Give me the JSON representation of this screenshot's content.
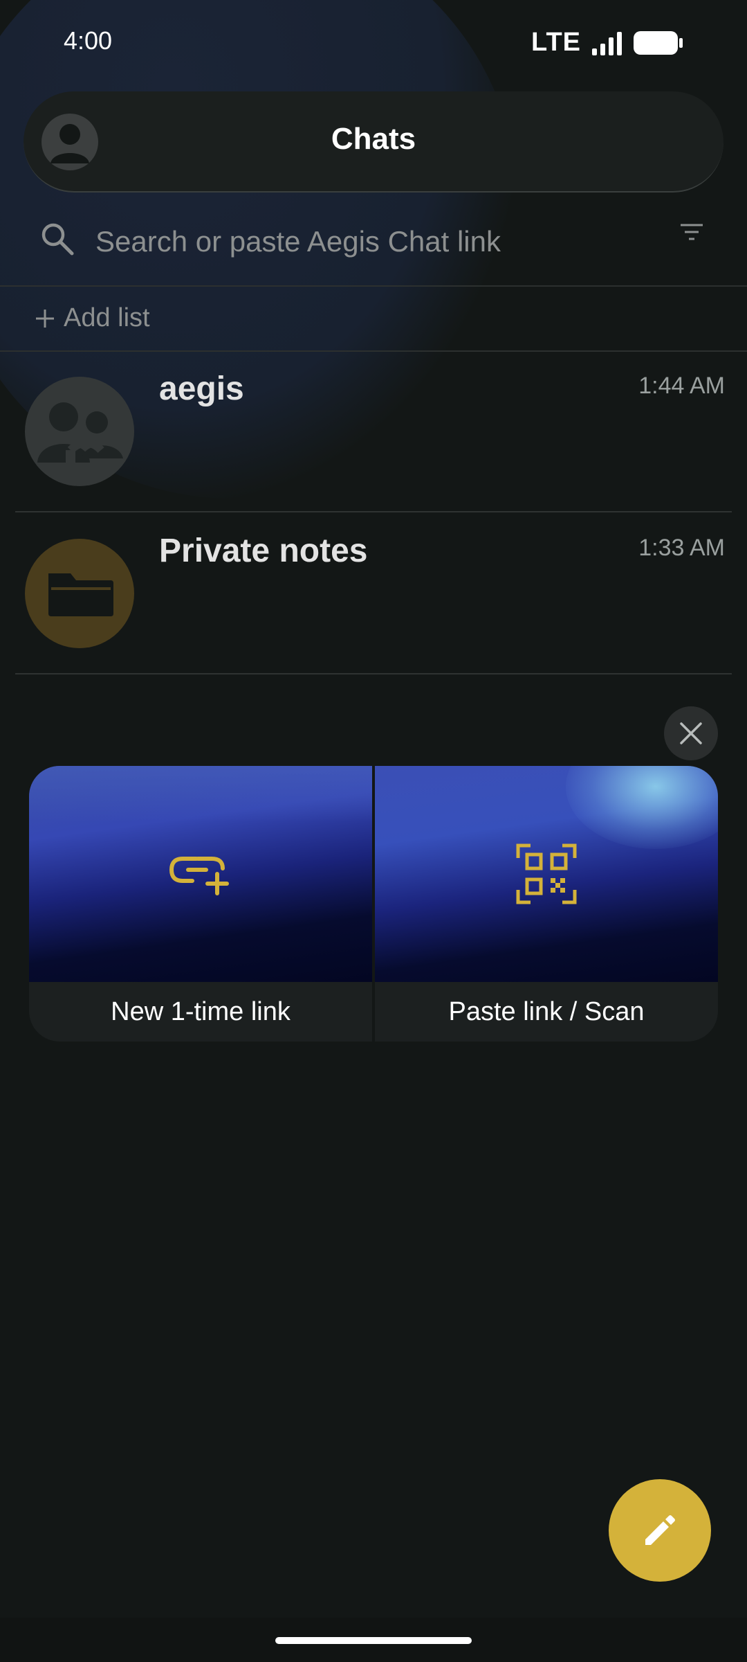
{
  "status_bar": {
    "time": "4:00",
    "network": "LTE"
  },
  "header": {
    "title": "Chats"
  },
  "search": {
    "placeholder": "Search or paste Aegis Chat link"
  },
  "add_list": {
    "label": "Add list"
  },
  "chats": [
    {
      "name": "aegis",
      "time": "1:44 AM",
      "icon": "group-icon"
    },
    {
      "name": "Private notes",
      "time": "1:33 AM",
      "icon": "folder-icon"
    }
  ],
  "cards": {
    "new_link_label": "New 1-time link",
    "scan_label": "Paste link / Scan"
  },
  "colors": {
    "accent": "#d4b23a",
    "background": "#131716"
  }
}
